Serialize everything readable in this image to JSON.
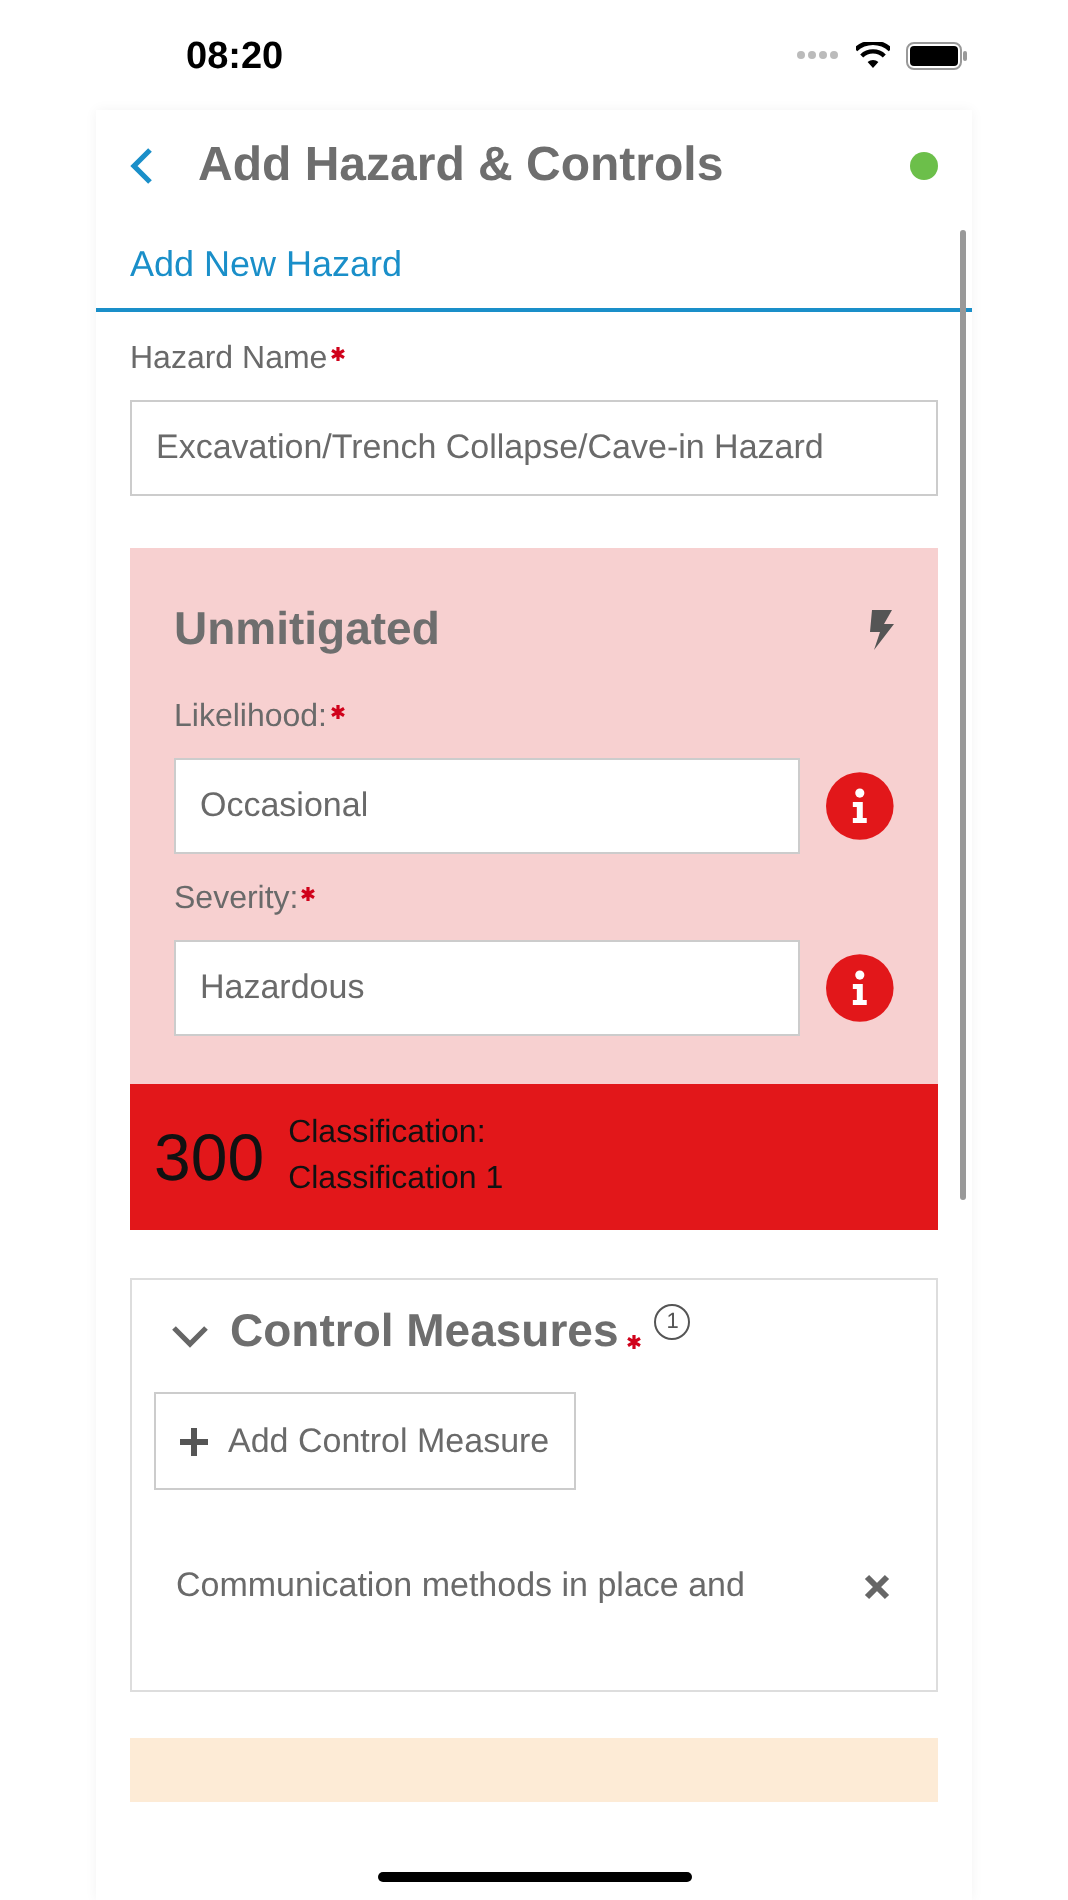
{
  "status_bar": {
    "time": "08:20"
  },
  "header": {
    "title": "Add Hazard & Controls",
    "online": true
  },
  "tabs": [
    {
      "label": "Add New Hazard",
      "selected": true
    }
  ],
  "hazard_name": {
    "label": "Hazard Name",
    "required": true,
    "value": "Excavation/Trench Collapse/Cave-in Hazard"
  },
  "unmitigated": {
    "title": "Unmitigated",
    "fields": [
      {
        "label": "Likelihood:",
        "required": true,
        "value": "Occasional"
      },
      {
        "label": "Severity:",
        "required": true,
        "value": "Hazardous"
      }
    ],
    "score": "300",
    "classification_label": "Classification:",
    "classification": "Classification 1"
  },
  "control_measures": {
    "title": "Control Measures",
    "required": true,
    "count": "1",
    "expanded": true,
    "add_button": "Add Control Measure",
    "items": [
      {
        "text": "Communication methods in place and"
      }
    ]
  }
}
